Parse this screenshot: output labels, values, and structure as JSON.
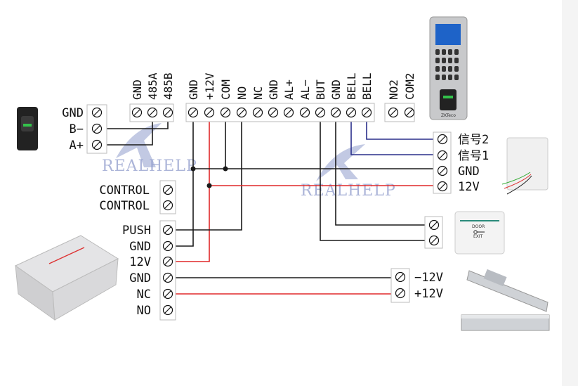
{
  "colors": {
    "wire_black": "#1a1a1a",
    "wire_red": "#e0282a",
    "wire_blue": "#2a2f8a",
    "watermark": "#8f9ccc"
  },
  "watermark": "REALHELP",
  "reader_terminals": [
    "GND",
    "B−",
    "A+"
  ],
  "rs485_terminals": [
    "GND",
    "485A",
    "485B"
  ],
  "main_terminals": [
    "GND",
    "+12V",
    "COM",
    "NO",
    "NC",
    "GND",
    "AL+",
    "AL−",
    "BUT",
    "GND",
    "BELL",
    "BELL"
  ],
  "aux_terminals": [
    "NO2",
    "COM2"
  ],
  "control_terminals": [
    "CONTROL",
    "CONTROL"
  ],
  "psu_terminals": [
    "PUSH",
    "GND",
    "12V",
    "GND",
    "NC",
    "NO"
  ],
  "doorbell_terminals": [
    "信号2",
    "信号1",
    "GND",
    "12V"
  ],
  "lock_terminals": [
    "−12V",
    "+12V"
  ],
  "exit_button": {
    "line1": "DOOR",
    "line2": "EXIT"
  },
  "device_brand": "ZKTeco"
}
